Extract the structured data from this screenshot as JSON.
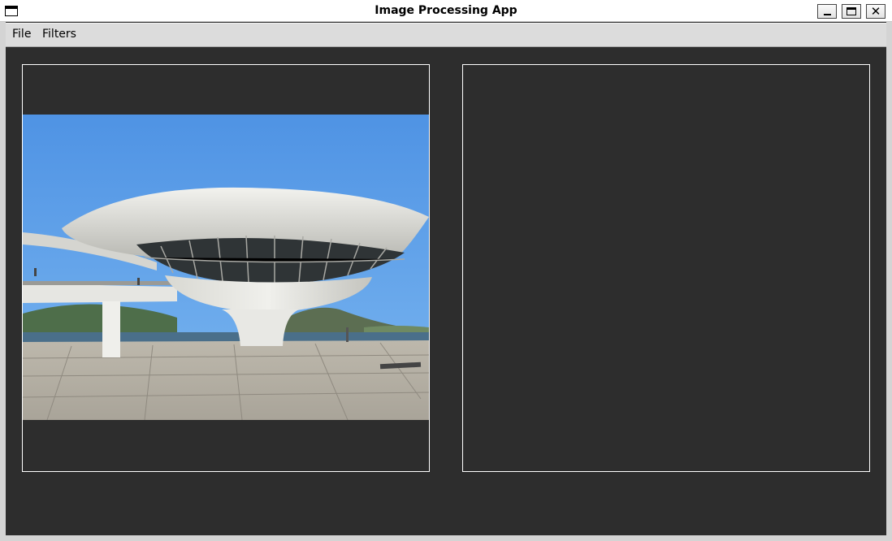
{
  "window": {
    "title": "Image Processing App",
    "controls": {
      "minimize": "_",
      "maximize": "□",
      "close": "✕"
    }
  },
  "menubar": {
    "items": [
      {
        "label": "File"
      },
      {
        "label": "Filters"
      }
    ]
  },
  "panels": {
    "original": {
      "icon": "photo-image",
      "has_image": true
    },
    "processed": {
      "has_image": false
    }
  },
  "colors": {
    "background": "#2d2d2d",
    "panel_border": "#ffffff",
    "menubar": "#dcdcdc",
    "sky": "#5e9ee6"
  }
}
